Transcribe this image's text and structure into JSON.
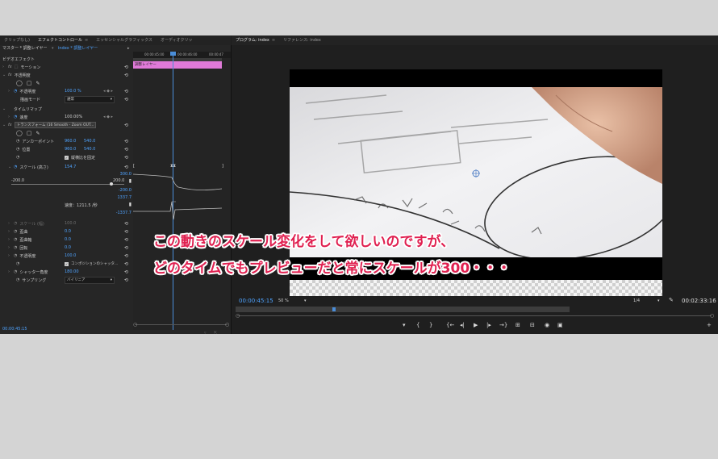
{
  "left_tabs": [
    {
      "label": "クリップなし)",
      "active": false
    },
    {
      "label": "エフェクトコントロール",
      "active": true
    },
    {
      "label": "エッセンシャルグラフィックス",
      "active": false
    },
    {
      "label": "オーディオクリッ",
      "active": false
    }
  ],
  "right_tabs": [
    {
      "label": "プログラム: index",
      "active": true
    },
    {
      "label": "リファレンス: index",
      "active": false
    }
  ],
  "master": {
    "label": "マスター * 調整レイヤー",
    "clip": "index * 調整レイヤー"
  },
  "ruler": {
    "t1": "00:00:45:00",
    "t2": "00:00:46:00",
    "t3": "00:00:47"
  },
  "clip_bar_label": "調整レイヤー",
  "props": {
    "video_effects": "ビデオエフェクト",
    "motion": "モーション",
    "opacity": "不透明度",
    "opacity_inner": "不透明度",
    "opacity_value": "100.0 %",
    "blend_mode": "描画モード",
    "blend_value": "通常",
    "time_remap": "タイムリマップ",
    "speed": "速度",
    "speed_value": "100.00%",
    "transform": "トランスフォーム (16 Smooth - Zoom OUT...",
    "anchor": "アンカーポイント",
    "anchor_x": "960.0",
    "anchor_y": "540.0",
    "position": "位置",
    "position_x": "960.0",
    "position_y": "540.0",
    "uniform_scale": "縦横比を固定",
    "scale_height": "スケール (高さ)",
    "scale_value": "154.7",
    "graph_top": "300.0",
    "graph_left": "-200.0",
    "graph_right": "200.0",
    "graph_bottom": "-200.0",
    "vel_top": "1337.7",
    "velocity_label": "速度：1211.5 /秒",
    "vel_bottom": "-1337.7",
    "scale_width": "スケール (幅)",
    "scale_width_value": "100.0",
    "skew": "歪曲",
    "skew_value": "0.0",
    "skew_axis": "歪曲軸",
    "skew_axis_value": "0.0",
    "rotation": "回転",
    "rotation_value": "0.0",
    "opacity2": "不透明度",
    "opacity2_value": "100.0",
    "comp_shutter": "コンポジションのシャッタ...",
    "shutter_angle": "シャッター角度",
    "shutter_angle_value": "180.00",
    "sampling": "サンプリング",
    "sampling_value": "バイリニア"
  },
  "left_timecode": "00:00:45:15",
  "program": {
    "timecode": "00:00:45:15",
    "zoom": "50 %",
    "quality": "1/4",
    "duration": "00:02:33:16"
  },
  "overlay": {
    "line1": "この動きのスケール変化をして欲しいのですが、",
    "line2": "どのタイムでもプレビューだと常にスケールが300・・・"
  },
  "colors": {
    "accent": "#4fa3ff",
    "clip": "#e07ad8",
    "annotation": "#e02050"
  }
}
